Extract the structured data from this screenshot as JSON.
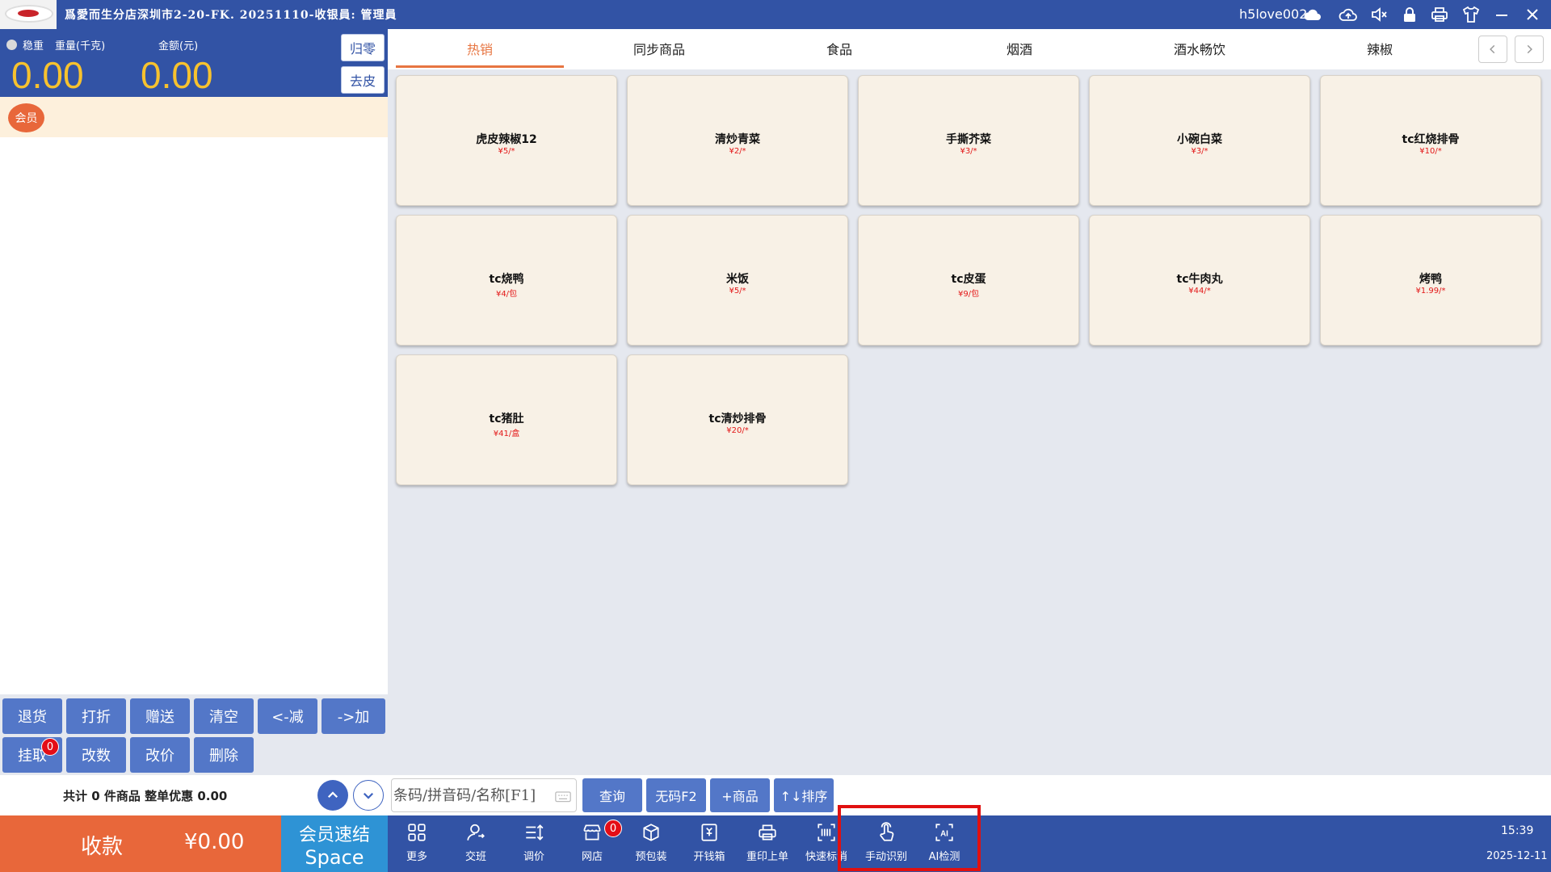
{
  "window": {
    "title": "爲愛而生分店深圳市2-20-FK. 20251110-收银員: 管理員",
    "user": "h5love002"
  },
  "scale": {
    "stable_label": "稳重",
    "weight_label": "重量(千克)",
    "amount_label": "金额(元)",
    "weight_value": "0.00",
    "amount_value": "0.00",
    "zero_button": "归零",
    "tare_button": "去皮"
  },
  "member": {
    "badge": "会员"
  },
  "actions_row1": [
    "退货",
    "打折",
    "赠送",
    "清空",
    "<-减",
    "->加"
  ],
  "actions_row2": [
    "挂取",
    "改数",
    "改价",
    "删除"
  ],
  "hold_badge": "0",
  "summary": "共计 0 件商品 整单优惠 0.00",
  "tabs": [
    "热销",
    "同步商品",
    "食品",
    "烟酒",
    "酒水畅饮",
    "辣椒"
  ],
  "active_tab": 0,
  "products": [
    {
      "name": "虎皮辣椒12",
      "price": "¥5/*"
    },
    {
      "name": "清炒青菜",
      "price": "¥2/*"
    },
    {
      "name": "手撕芥菜",
      "price": "¥3/*"
    },
    {
      "name": "小碗白菜",
      "price": "¥3/*"
    },
    {
      "name": "tc红烧排骨",
      "price": "¥10/*"
    },
    {
      "name": "tc烧鸭",
      "price": "¥4/包"
    },
    {
      "name": "米饭",
      "price": "¥5/*"
    },
    {
      "name": "tc皮蛋",
      "price": "¥9/包"
    },
    {
      "name": "tc牛肉丸",
      "price": "¥44/*"
    },
    {
      "name": "烤鸭",
      "price": "¥1.99/*"
    },
    {
      "name": "tc猪肚",
      "price": "¥41/盒"
    },
    {
      "name": "tc清炒排骨",
      "price": "¥20/*"
    }
  ],
  "search": {
    "placeholder": "条码/拼音码/名称[F1]",
    "query_button": "查询",
    "no_code_button": "无码F2",
    "add_product_button": "+商品",
    "sort_button": "↑↓排序"
  },
  "checkout": {
    "label": "收款",
    "amount": "¥0.00"
  },
  "member_quick": {
    "label": "会员速结",
    "key": "Space"
  },
  "toolbar": [
    {
      "label": "更多",
      "icon": "grid-icon"
    },
    {
      "label": "交班",
      "icon": "user-icon"
    },
    {
      "label": "调价",
      "icon": "price-adjust-icon"
    },
    {
      "label": "网店",
      "icon": "store-icon"
    },
    {
      "label": "预包装",
      "icon": "package-icon"
    },
    {
      "label": "开钱箱",
      "icon": "cash-drawer-icon"
    },
    {
      "label": "重印上单",
      "icon": "printer-icon"
    },
    {
      "label": "快速标消",
      "icon": "barcode-icon"
    },
    {
      "label": "手动识别",
      "icon": "touch-icon"
    },
    {
      "label": "AI检测",
      "icon": "ai-scan-icon"
    }
  ],
  "webstore_badge": "0",
  "clock": {
    "time": "15:39",
    "date": "2025-12-11"
  }
}
